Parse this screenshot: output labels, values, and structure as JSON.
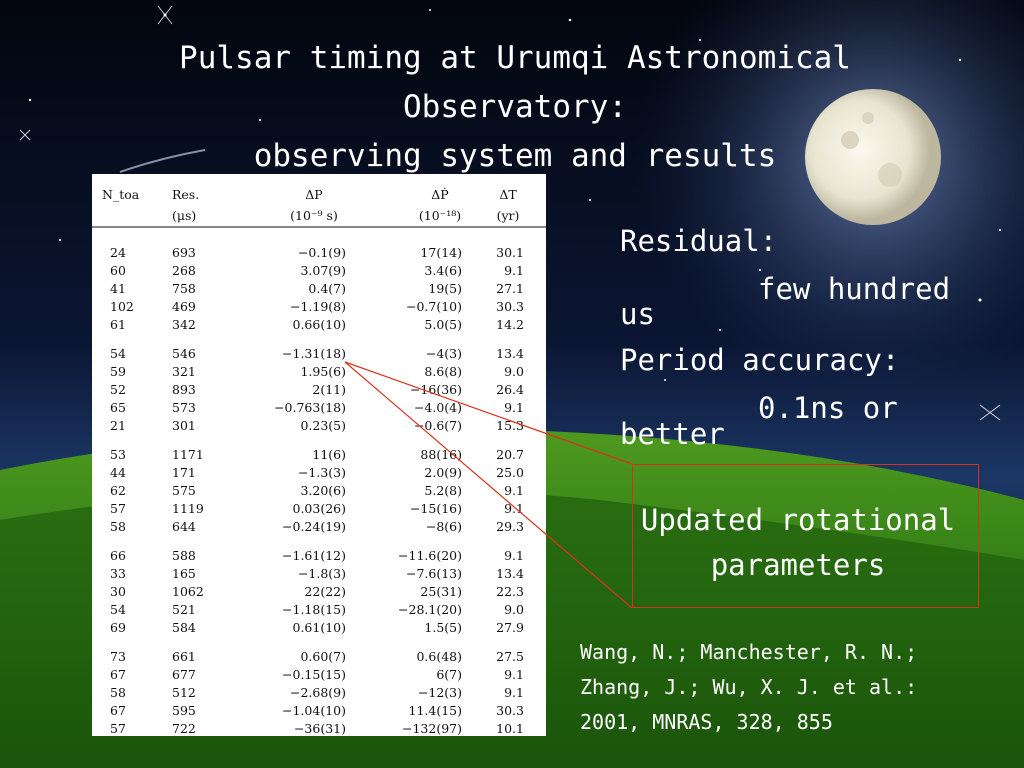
{
  "slide": {
    "title": "Pulsar timing at Urumqi Astronomical\nObservatory:\nobserving system and results",
    "residual_label": "Residual:",
    "residual_value": "few hundred",
    "residual_unit": "us",
    "period_label": "Period accuracy:",
    "period_value": "0.1ns or",
    "period_tail": "better",
    "callout": "Updated rotational\nparameters",
    "reference": {
      "line1": "Wang, N.; Manchester, R. N.;",
      "line2": "Zhang, J.; Wu, X. J. et al.:",
      "line3": "2001, MNRAS, 328, 855"
    },
    "colors": {
      "callout_red": "#d8321c",
      "sky_top": "#050a1c",
      "grass": "#2f7a14"
    }
  },
  "table": {
    "headers": [
      {
        "l1": "N_toa",
        "l2": ""
      },
      {
        "l1": "Res.",
        "l2": "(μs)"
      },
      {
        "l1": "ΔP",
        "l2": "(10⁻⁹ s)"
      },
      {
        "l1": "ΔṖ",
        "l2": "(10⁻¹⁸)"
      },
      {
        "l1": "ΔT",
        "l2": "(yr)"
      }
    ],
    "groups": [
      [
        [
          "24",
          "693",
          "−0.1(9)",
          "17(14)",
          "30.1"
        ],
        [
          "60",
          "268",
          "3.07(9)",
          "3.4(6)",
          "9.1"
        ],
        [
          "41",
          "758",
          "0.4(7)",
          "19(5)",
          "27.1"
        ],
        [
          "102",
          "469",
          "−1.19(8)",
          "−0.7(10)",
          "30.3"
        ],
        [
          "61",
          "342",
          "0.66(10)",
          "5.0(5)",
          "14.2"
        ]
      ],
      [
        [
          "54",
          "546",
          "−1.31(18)",
          "−4(3)",
          "13.4"
        ],
        [
          "59",
          "321",
          "1.95(6)",
          "8.6(8)",
          "9.0"
        ],
        [
          "52",
          "893",
          "2(11)",
          "−16(36)",
          "26.4"
        ],
        [
          "65",
          "573",
          "−0.763(18)",
          "−4.0(4)",
          "9.1"
        ],
        [
          "21",
          "301",
          "0.23(5)",
          "−0.6(7)",
          "15.3"
        ]
      ],
      [
        [
          "53",
          "1171",
          "11(6)",
          "88(16)",
          "20.7"
        ],
        [
          "44",
          "171",
          "−1.3(3)",
          "2.0(9)",
          "25.0"
        ],
        [
          "62",
          "575",
          "3.20(6)",
          "5.2(8)",
          "9.1"
        ],
        [
          "57",
          "1119",
          "0.03(26)",
          "−15(16)",
          "9.1"
        ],
        [
          "58",
          "644",
          "−0.24(19)",
          "−8(6)",
          "29.3"
        ]
      ],
      [
        [
          "66",
          "588",
          "−1.61(12)",
          "−11.6(20)",
          "9.1"
        ],
        [
          "33",
          "165",
          "−1.8(3)",
          "−7.6(13)",
          "13.4"
        ],
        [
          "30",
          "1062",
          "22(22)",
          "25(31)",
          "22.3"
        ],
        [
          "54",
          "521",
          "−1.18(15)",
          "−28.1(20)",
          "9.0"
        ],
        [
          "69",
          "584",
          "0.61(10)",
          "1.5(5)",
          "27.9"
        ]
      ],
      [
        [
          "73",
          "661",
          "0.60(7)",
          "0.6(48)",
          "27.5"
        ],
        [
          "67",
          "677",
          "−0.15(15)",
          "6(7)",
          "9.1"
        ],
        [
          "58",
          "512",
          "−2.68(9)",
          "−12(3)",
          "9.1"
        ],
        [
          "67",
          "595",
          "−1.04(10)",
          "11.4(15)",
          "30.3"
        ],
        [
          "57",
          "722",
          "−36(31)",
          "−132(97)",
          "10.1"
        ]
      ]
    ]
  }
}
